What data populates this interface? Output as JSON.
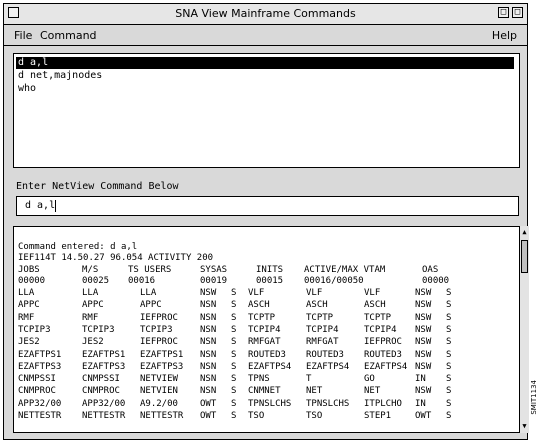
{
  "window": {
    "title": "SNA View Mainframe Commands",
    "minimize_glyph": "□",
    "maximize_glyph": "□"
  },
  "menu": {
    "file": "File",
    "command": "Command",
    "help": "Help"
  },
  "history": [
    "d a,l",
    "d net,majnodes",
    "who"
  ],
  "prompt_label": "Enter NetView Command Below",
  "command_input": {
    "value": "d a,l"
  },
  "output": {
    "command_echo": "Command entered: d a,l",
    "status_line": "IEF114T 14.50.27 96.054 ACTIVITY 200",
    "summary_header": [
      "JOBS",
      "M/S",
      "TS USERS",
      "SYSAS",
      "INITS",
      "ACTIVE/MAX VTAM",
      "OAS"
    ],
    "summary_values": [
      "00000",
      "00025",
      "00016",
      "00019",
      "00015",
      "00016/00050",
      "00000"
    ],
    "rows": [
      [
        "LLA",
        "LLA",
        "LLA",
        "NSW",
        "S",
        "VLF",
        "VLF",
        "VLF",
        "NSW",
        "S"
      ],
      [
        "APPC",
        "APPC",
        "APPC",
        "NSN",
        "S",
        "ASCH",
        "ASCH",
        "ASCH",
        "NSW",
        "S"
      ],
      [
        "RMF",
        "RMF",
        "IEFPROC",
        "NSN",
        "S",
        "TCPTP",
        "TCPTP",
        "TCPTP",
        "NSW",
        "S"
      ],
      [
        "TCPIP3",
        "TCPIP3",
        "TCPIP3",
        "NSN",
        "S",
        "TCPIP4",
        "TCPIP4",
        "TCPIP4",
        "NSW",
        "S"
      ],
      [
        "JES2",
        "JES2",
        "IEFPROC",
        "NSN",
        "S",
        "RMFGAT",
        "RMFGAT",
        "IEFPROC",
        "NSW",
        "S"
      ],
      [
        "EZAFTPS1",
        "EZAFTPS1",
        "EZAFTPS1",
        "NSN",
        "S",
        "ROUTED3",
        "ROUTED3",
        "ROUTED3",
        "NSW",
        "S"
      ],
      [
        "EZAFTPS3",
        "EZAFTPS3",
        "EZAFTPS3",
        "NSN",
        "S",
        "EZAFTPS4",
        "EZAFTPS4",
        "EZAFTPS4",
        "NSW",
        "S"
      ],
      [
        "CNMPSSI",
        "CNMPSSI",
        "NETVIEW",
        "NSN",
        "S",
        "TPNS",
        "T",
        "GO",
        "IN",
        "S"
      ],
      [
        "CNMPROC",
        "CNMPROC",
        "NETVIEN",
        "NSN",
        "S",
        "CNMNET",
        "NET",
        "NET",
        "NSW",
        "S"
      ],
      [
        "APP32/00",
        "APP32/00",
        "A9.2/00",
        "OWT",
        "S",
        "TPNSLCHS",
        "TPNSLCHS",
        "ITPLCHO",
        "IN",
        "S"
      ],
      [
        "NETTESTR",
        "NETTESTR",
        "NETTESTR",
        "OWT",
        "S",
        "TSO",
        "TSO",
        "STEP1",
        "OWT",
        "S"
      ]
    ]
  },
  "side_caption": "SMIT1134"
}
